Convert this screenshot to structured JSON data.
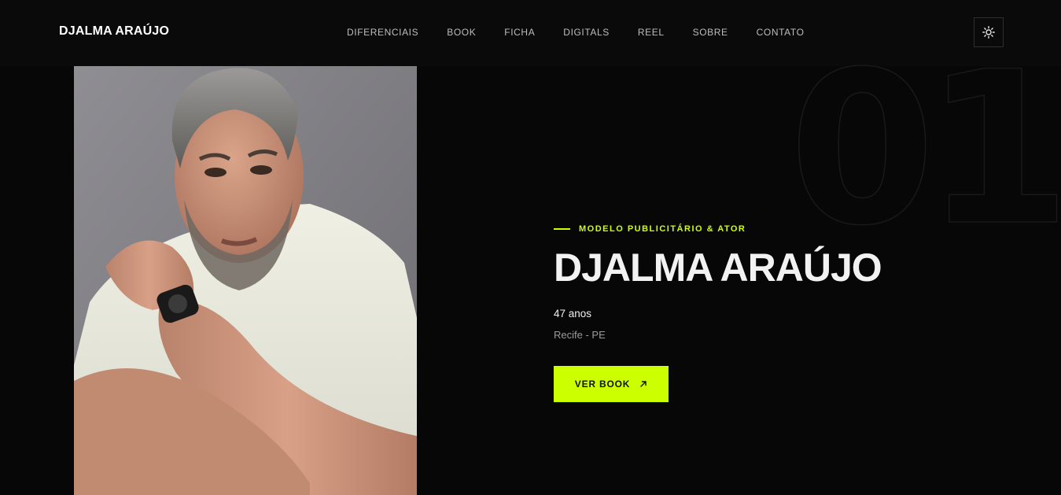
{
  "header": {
    "brand": "DJALMA ARAÚJO",
    "nav": [
      {
        "label": "DIFERENCIAIS"
      },
      {
        "label": "BOOK"
      },
      {
        "label": "FICHA"
      },
      {
        "label": "DIGITALS"
      },
      {
        "label": "REEL"
      },
      {
        "label": "SOBRE"
      },
      {
        "label": "CONTATO"
      }
    ],
    "theme_toggle_icon": "sun-icon"
  },
  "hero": {
    "background_number": "01",
    "eyebrow": "MODELO PUBLICITÁRIO & ATOR",
    "name": "DJALMA ARAÚJO",
    "age": "47 anos",
    "location": "Recife - PE",
    "cta_label": "VER BOOK",
    "cta_icon": "arrow-up-right-icon"
  },
  "colors": {
    "accent": "#ccff00",
    "background": "#070707",
    "navbar": "#0a0a0a"
  }
}
